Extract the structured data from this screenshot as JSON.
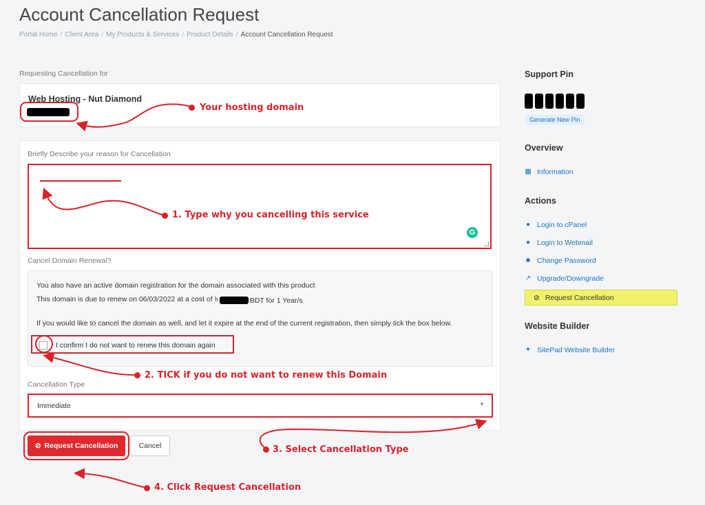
{
  "page": {
    "title": "Account Cancellation Request",
    "breadcrumb": [
      "Portal Home",
      "Client Area",
      "My Products & Services",
      "Product Details",
      "Account Cancellation Request"
    ]
  },
  "form": {
    "requesting_label": "Requesting Cancellation for",
    "product_name": "Web Hosting - Nut Diamond",
    "reason_label": "Briefly Describe your reason for Cancellation",
    "domain_renewal_label": "Cancel Domain Renewal?",
    "domain_info_line1": "You also have an active domain registration for the domain associated with this product",
    "domain_info_line2_prefix": "This domain is due to renew on 06/03/2022 at a cost of ৳",
    "domain_info_line2_suffix": "BDT for 1 Year/s",
    "domain_info_line3": "If you would like to cancel the domain as well, and let it expire at the end of the current registration, then simply tick the box below.",
    "confirm_checkbox_label": "I confirm I do not want to renew this domain again",
    "confirm_checked": false,
    "cancellation_type_label": "Cancellation Type",
    "cancellation_type_value": "Immediate",
    "request_button": "Request Cancellation",
    "cancel_button": "Cancel"
  },
  "annotations": {
    "hosting_domain": "Your hosting domain",
    "step1": "1. Type why you cancelling this service",
    "step2": "2. TICK if you do not want to renew this Domain",
    "step3": "3. Select Cancellation Type",
    "step4": "4. Click Request Cancellation",
    "color": "#d8232a"
  },
  "sidebar": {
    "support_pin_heading": "Support Pin",
    "generate_pin": "Generate New Pin",
    "overview_heading": "Overview",
    "overview_items": [
      {
        "label": "Information",
        "icon": "grid-icon"
      }
    ],
    "actions_heading": "Actions",
    "action_items": [
      {
        "label": "Login to cPanel",
        "icon": "user-icon"
      },
      {
        "label": "Login to Webmail",
        "icon": "user-icon"
      },
      {
        "label": "Change Password",
        "icon": "lock-icon"
      },
      {
        "label": "Upgrade/Downgrade",
        "icon": "external-link-icon"
      },
      {
        "label": "Request Cancellation",
        "icon": "ban-icon",
        "active": true
      }
    ],
    "website_builder_heading": "Website Builder",
    "builder_items": [
      {
        "label": "SitePad Website Builder",
        "icon": "magic-wand-icon"
      }
    ],
    "active_highlight_color": "#f0f26c"
  }
}
